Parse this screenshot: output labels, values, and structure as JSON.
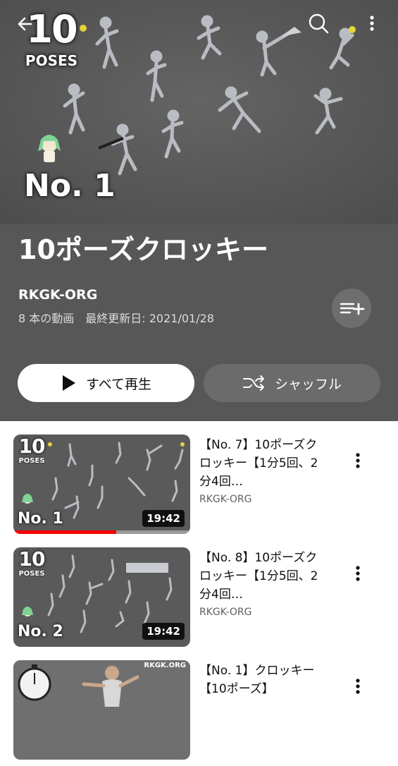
{
  "header": {
    "icons": {
      "back": "back-arrow-icon",
      "search": "search-icon",
      "more": "more-vert-icon"
    },
    "hero": {
      "logo_number": "10",
      "logo_text": "POSES",
      "episode": "No. 1"
    },
    "title": "10ポーズクロッキー",
    "channel": "RKGK-ORG",
    "meta": "8 本の動画　最終更新日: 2021/01/28",
    "add_icon": "playlist-add-icon",
    "play_all_label": "すべて再生",
    "shuffle_label": "シャッフル",
    "colors": {
      "header_bg": "#575757",
      "play_bg": "#ffffff",
      "shuffle_bg": "#6b6b6b"
    }
  },
  "videos": [
    {
      "title": "【No. 7】10ポーズクロッキー【1分5回、2分4回…",
      "channel": "RKGK-ORG",
      "duration": "19:42",
      "thumb_number": "10",
      "thumb_text": "POSES",
      "thumb_episode": "No. 1",
      "progress": 0.58
    },
    {
      "title": "【No. 8】10ポーズクロッキー【1分5回、2分4回…",
      "channel": "RKGK-ORG",
      "duration": "19:42",
      "thumb_number": "10",
      "thumb_text": "POSES",
      "thumb_episode": "No. 2"
    },
    {
      "title": "【No. 1】クロッキー【10ポーズ】",
      "channel": "",
      "thumb_watermark": "RKGK.ORG"
    }
  ],
  "accent_color": "#ff0000"
}
